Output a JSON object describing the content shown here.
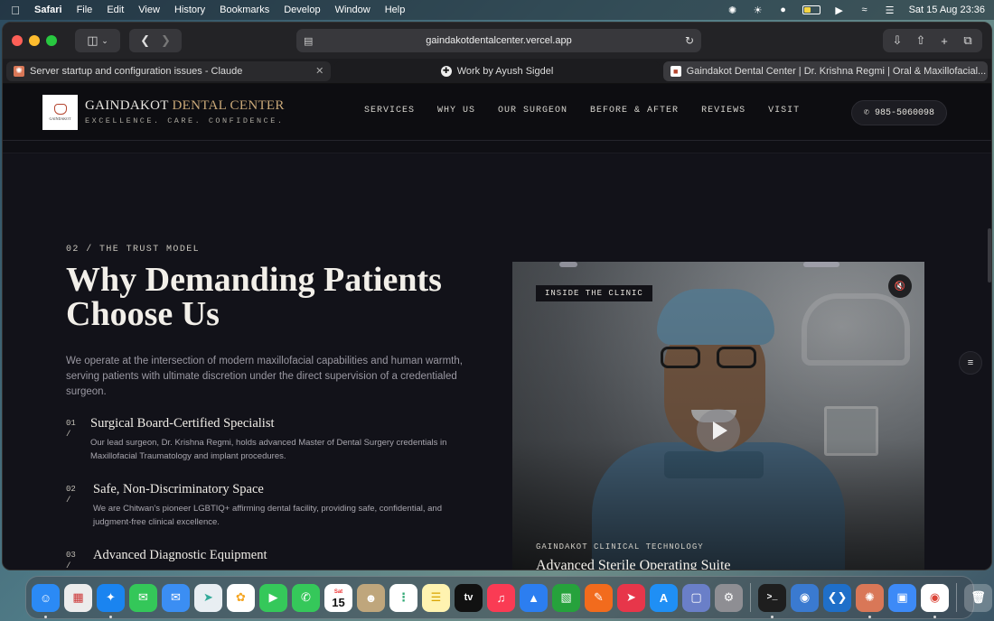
{
  "menubar": {
    "app": "Safari",
    "items": [
      "File",
      "Edit",
      "View",
      "History",
      "Bookmarks",
      "Develop",
      "Window",
      "Help"
    ],
    "datetime": "Sat 15 Aug  23:36"
  },
  "browser": {
    "address": "gaindakotdentalcenter.vercel.app",
    "tabs": [
      {
        "title": "Server startup and configuration issues - Claude"
      },
      {
        "title": "Work by Ayush Sigdel"
      },
      {
        "title": "Gaindakot Dental Center | Dr. Krishna Regmi | Oral & Maxillofacial..."
      }
    ]
  },
  "site": {
    "logo_text": "GAINDAKOT",
    "brand_main": "GAINDAKOT",
    "brand_accent": "DENTAL CENTER",
    "tagline": "EXCELLENCE. CARE. CONFIDENCE.",
    "nav": [
      "SERVICES",
      "WHY US",
      "OUR SURGEON",
      "BEFORE & AFTER",
      "REVIEWS",
      "VISIT"
    ],
    "phone": "985-5060098"
  },
  "section": {
    "eyebrow": "02 / THE TRUST MODEL",
    "headline_line1": "Why Demanding Patients",
    "headline_line2": "Choose Us",
    "intro": "We operate at the intersection of modern maxillofacial capabilities and human warmth, serving patients with ultimate discretion under the direct supervision of a credentialed surgeon.",
    "features": [
      {
        "num": "01\n/",
        "title": "Surgical Board-Certified Specialist",
        "desc": "Our lead surgeon, Dr. Krishna Regmi, holds advanced Master of Dental Surgery credentials in Maxillofacial Traumatology and implant procedures."
      },
      {
        "num": "02\n/",
        "title": "Safe, Non-Discriminatory Space",
        "desc": "We are Chitwan's pioneer LGBTIQ+ affirming dental facility, providing safe, confidential, and judgment-free clinical excellence."
      },
      {
        "num": "03\n/",
        "title": "Advanced Diagnostic Equipment",
        "desc": ""
      }
    ]
  },
  "video": {
    "badge": "INSIDE THE CLINIC",
    "caption_kicker": "GAINDAKOT CLINICAL TECHNOLOGY",
    "caption_title": "Advanced Sterile Operating Suite"
  },
  "dock": {
    "calendar_month": "Sat",
    "calendar_day": "15",
    "tv_label": "tv"
  },
  "colors": {
    "accent_gold": "#c9a878",
    "page_bg": "#121219",
    "header_bg": "#0d0d11"
  }
}
